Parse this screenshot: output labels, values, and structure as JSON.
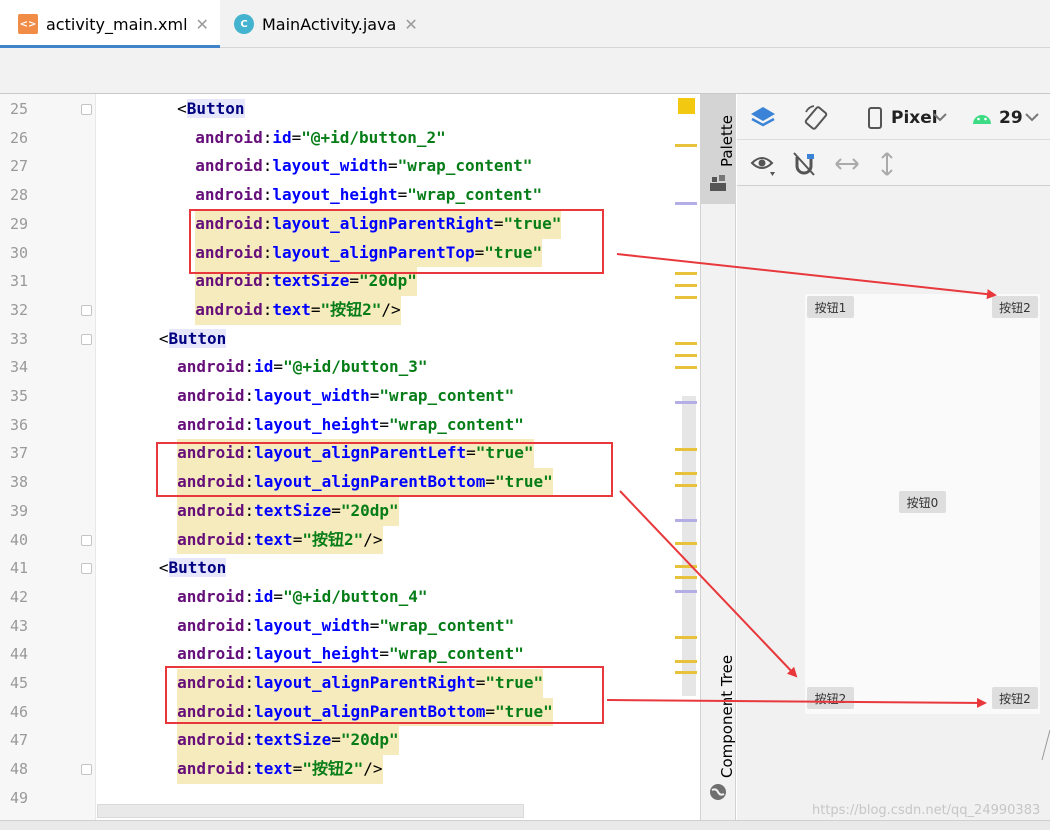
{
  "tabs": [
    {
      "label": "activity_main.xml",
      "icon": "xml-file-icon",
      "active": true
    },
    {
      "label": "MainActivity.java",
      "icon": "java-class-icon",
      "active": false
    }
  ],
  "editor": {
    "lines": [
      {
        "n": "25",
        "indent": 44,
        "parts": [
          [
            "pn",
            "<"
          ],
          [
            "tg",
            "Button"
          ]
        ],
        "bg": "tag",
        "fold": true
      },
      {
        "n": "26",
        "indent": 54,
        "parts": [
          [
            "ns",
            "android"
          ],
          [
            "pn",
            ":"
          ],
          [
            "at",
            "id"
          ],
          [
            "pn",
            "="
          ],
          [
            "st",
            "\"@+id/button_2\""
          ]
        ]
      },
      {
        "n": "27",
        "indent": 54,
        "parts": [
          [
            "ns",
            "android"
          ],
          [
            "pn",
            ":"
          ],
          [
            "at",
            "layout_width"
          ],
          [
            "pn",
            "="
          ],
          [
            "st",
            "\"wrap_content\""
          ]
        ]
      },
      {
        "n": "28",
        "indent": 54,
        "parts": [
          [
            "ns",
            "android"
          ],
          [
            "pn",
            ":"
          ],
          [
            "at",
            "layout_height"
          ],
          [
            "pn",
            "="
          ],
          [
            "st",
            "\"wrap_content\""
          ]
        ]
      },
      {
        "n": "29",
        "indent": 54,
        "parts": [
          [
            "ns",
            "android"
          ],
          [
            "pn",
            ":"
          ],
          [
            "at",
            "layout_alignParentRight"
          ],
          [
            "pn",
            "="
          ],
          [
            "st",
            "\"true\""
          ]
        ],
        "hl": true
      },
      {
        "n": "30",
        "indent": 54,
        "parts": [
          [
            "ns",
            "android"
          ],
          [
            "pn",
            ":"
          ],
          [
            "at",
            "layout_alignParentTop"
          ],
          [
            "pn",
            "="
          ],
          [
            "st",
            "\"true\""
          ]
        ],
        "hl": true
      },
      {
        "n": "31",
        "indent": 54,
        "parts": [
          [
            "ns",
            "android"
          ],
          [
            "pn",
            ":"
          ],
          [
            "at",
            "textSize"
          ],
          [
            "pn",
            "="
          ],
          [
            "st",
            "\"20dp\""
          ]
        ],
        "hl": true
      },
      {
        "n": "32",
        "indent": 54,
        "parts": [
          [
            "ns",
            "android"
          ],
          [
            "pn",
            ":"
          ],
          [
            "at",
            "text"
          ],
          [
            "pn",
            "="
          ],
          [
            "st",
            "\"按钮2\""
          ],
          [
            "pn",
            "/>"
          ]
        ],
        "hl": true,
        "fold": true
      },
      {
        "n": "33",
        "indent": 34,
        "parts": [
          [
            "pn",
            "<"
          ],
          [
            "tg",
            "Button"
          ]
        ],
        "bg": "tag",
        "fold": true
      },
      {
        "n": "34",
        "indent": 44,
        "parts": [
          [
            "ns",
            "android"
          ],
          [
            "pn",
            ":"
          ],
          [
            "at",
            "id"
          ],
          [
            "pn",
            "="
          ],
          [
            "st",
            "\"@+id/button_3\""
          ]
        ]
      },
      {
        "n": "35",
        "indent": 44,
        "parts": [
          [
            "ns",
            "android"
          ],
          [
            "pn",
            ":"
          ],
          [
            "at",
            "layout_width"
          ],
          [
            "pn",
            "="
          ],
          [
            "st",
            "\"wrap_content\""
          ]
        ]
      },
      {
        "n": "36",
        "indent": 44,
        "parts": [
          [
            "ns",
            "android"
          ],
          [
            "pn",
            ":"
          ],
          [
            "at",
            "layout_height"
          ],
          [
            "pn",
            "="
          ],
          [
            "st",
            "\"wrap_content\""
          ]
        ]
      },
      {
        "n": "37",
        "indent": 44,
        "parts": [
          [
            "ns",
            "android"
          ],
          [
            "pn",
            ":"
          ],
          [
            "at",
            "layout_alignParentLeft"
          ],
          [
            "pn",
            "="
          ],
          [
            "st",
            "\"true\""
          ]
        ],
        "hl": true
      },
      {
        "n": "38",
        "indent": 44,
        "parts": [
          [
            "ns",
            "android"
          ],
          [
            "pn",
            ":"
          ],
          [
            "at",
            "layout_alignParentBottom"
          ],
          [
            "pn",
            "="
          ],
          [
            "st",
            "\"true\""
          ]
        ],
        "hl": true
      },
      {
        "n": "39",
        "indent": 44,
        "parts": [
          [
            "ns",
            "android"
          ],
          [
            "pn",
            ":"
          ],
          [
            "at",
            "textSize"
          ],
          [
            "pn",
            "="
          ],
          [
            "st",
            "\"20dp\""
          ]
        ],
        "hl": true
      },
      {
        "n": "40",
        "indent": 44,
        "parts": [
          [
            "ns",
            "android"
          ],
          [
            "pn",
            ":"
          ],
          [
            "at",
            "text"
          ],
          [
            "pn",
            "="
          ],
          [
            "st",
            "\"按钮2\""
          ],
          [
            "pn",
            "/>"
          ]
        ],
        "hl": true,
        "fold": true
      },
      {
        "n": "41",
        "indent": 34,
        "parts": [
          [
            "pn",
            "<"
          ],
          [
            "tg",
            "Button"
          ]
        ],
        "bg": "tag",
        "fold": true
      },
      {
        "n": "42",
        "indent": 44,
        "parts": [
          [
            "ns",
            "android"
          ],
          [
            "pn",
            ":"
          ],
          [
            "at",
            "id"
          ],
          [
            "pn",
            "="
          ],
          [
            "st",
            "\"@+id/button_4\""
          ]
        ]
      },
      {
        "n": "43",
        "indent": 44,
        "parts": [
          [
            "ns",
            "android"
          ],
          [
            "pn",
            ":"
          ],
          [
            "at",
            "layout_width"
          ],
          [
            "pn",
            "="
          ],
          [
            "st",
            "\"wrap_content\""
          ]
        ]
      },
      {
        "n": "44",
        "indent": 44,
        "parts": [
          [
            "ns",
            "android"
          ],
          [
            "pn",
            ":"
          ],
          [
            "at",
            "layout_height"
          ],
          [
            "pn",
            "="
          ],
          [
            "st",
            "\"wrap_content\""
          ]
        ]
      },
      {
        "n": "45",
        "indent": 44,
        "parts": [
          [
            "ns",
            "android"
          ],
          [
            "pn",
            ":"
          ],
          [
            "at",
            "layout_alignParentRight"
          ],
          [
            "pn",
            "="
          ],
          [
            "st",
            "\"true\""
          ]
        ],
        "hl": true
      },
      {
        "n": "46",
        "indent": 44,
        "parts": [
          [
            "ns",
            "android"
          ],
          [
            "pn",
            ":"
          ],
          [
            "at",
            "layout_alignParentBottom"
          ],
          [
            "pn",
            "="
          ],
          [
            "st",
            "\"true\""
          ]
        ],
        "hl": true
      },
      {
        "n": "47",
        "indent": 44,
        "parts": [
          [
            "ns",
            "android"
          ],
          [
            "pn",
            ":"
          ],
          [
            "at",
            "textSize"
          ],
          [
            "pn",
            "="
          ],
          [
            "st",
            "\"20dp\""
          ]
        ],
        "hl": true
      },
      {
        "n": "48",
        "indent": 44,
        "parts": [
          [
            "ns",
            "android"
          ],
          [
            "pn",
            ":"
          ],
          [
            "at",
            "text"
          ],
          [
            "pn",
            "="
          ],
          [
            "st",
            "\"按钮2\""
          ],
          [
            "pn",
            "/>"
          ]
        ],
        "hl": true,
        "fold": true
      },
      {
        "n": "49",
        "indent": 0,
        "parts": []
      }
    ]
  },
  "side_panel": {
    "palette": "Palette",
    "component_tree": "Component Tree"
  },
  "design": {
    "device": "Pixel",
    "api": "29",
    "buttons": {
      "b1": "按钮1",
      "b2_top_right": "按钮2",
      "b0": "按钮0",
      "b2_bottom_left": "按钮2",
      "b2_bottom_right": "按钮2"
    }
  },
  "colors": {
    "highlight_box": "#e8383c",
    "arrow": "#e8383c",
    "attr_highlight": "#f6ebbc",
    "accent": "#4083c9"
  },
  "watermark": "https://blog.csdn.net/qq_24990383"
}
